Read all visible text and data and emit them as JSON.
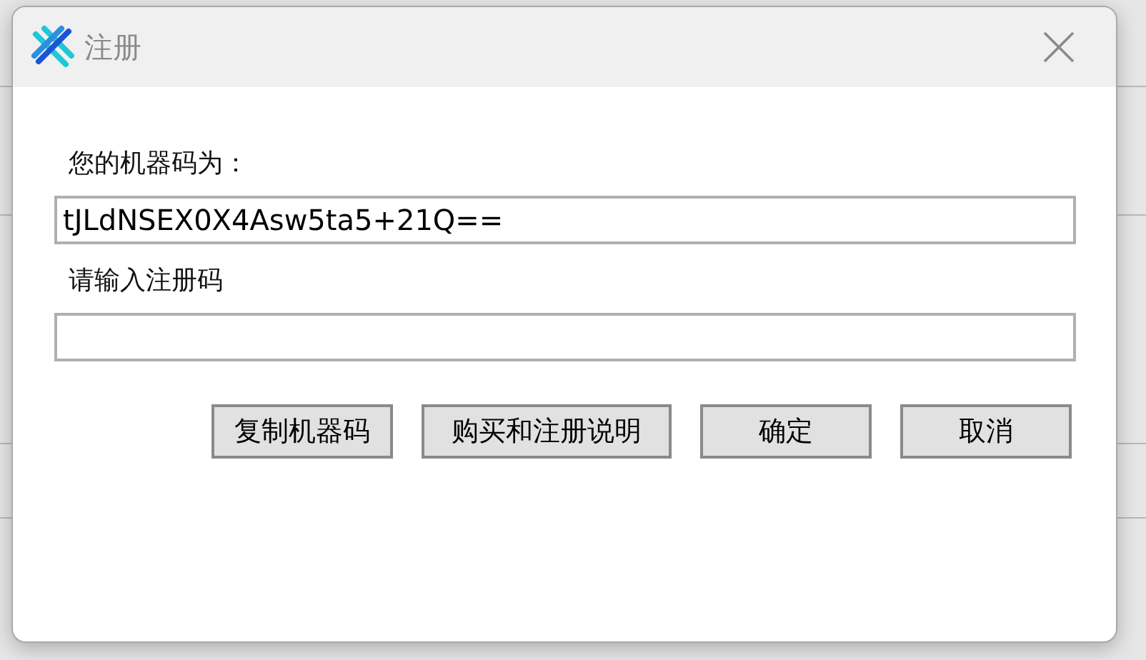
{
  "window": {
    "title": "注册"
  },
  "machine_code": {
    "label": "您的机器码为：",
    "value": "tJLdNSEX0X4Asw5ta5+21Q=="
  },
  "registration_code": {
    "label": "请输入注册码"
  },
  "buttons": [
    {
      "label": "复制机器码"
    },
    {
      "label": "购买和注册说明"
    },
    {
      "label": "确定"
    },
    {
      "label": "取消"
    }
  ]
}
